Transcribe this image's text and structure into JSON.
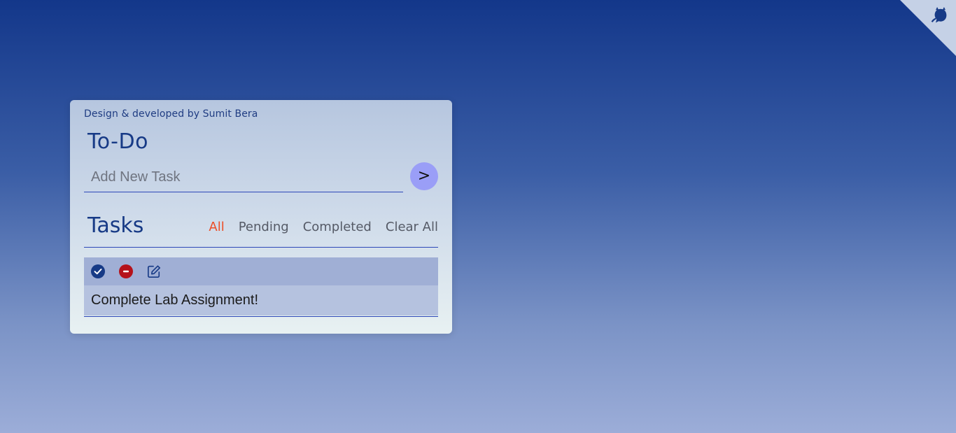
{
  "header": {
    "credit": "Design & developed by Sumit Bera",
    "app_title": "To-Do"
  },
  "new_task": {
    "placeholder": "Add New Task",
    "value": "",
    "submit_label": ">"
  },
  "tasks_section": {
    "title": "Tasks",
    "filters": [
      {
        "label": "All",
        "active": true
      },
      {
        "label": "Pending",
        "active": false
      },
      {
        "label": "Completed",
        "active": false
      }
    ],
    "clear_all_label": "Clear All"
  },
  "tasks": [
    {
      "text": "Complete Lab Assignment!",
      "actions": [
        "check-circle-icon",
        "remove-circle-icon",
        "edit-icon"
      ]
    }
  ],
  "colors": {
    "primary": "#173a86",
    "active_filter": "#ec4d26",
    "danger": "#b5121b",
    "add_button": "#9a9ef7"
  },
  "corner_icon": "github-octocat-icon"
}
